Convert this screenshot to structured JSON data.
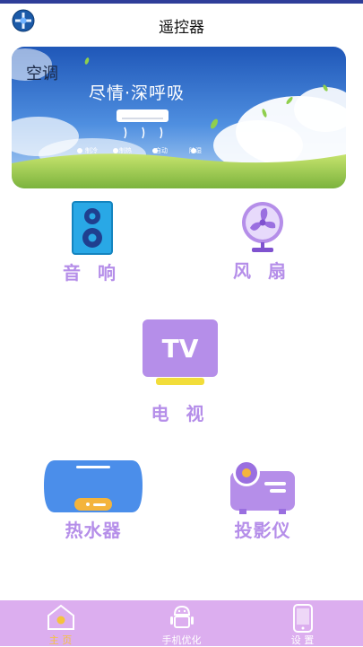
{
  "header": {
    "title": "遥控器",
    "logo_icon": "globe-icon"
  },
  "banner": {
    "label": "空调",
    "slogan": "尽情·深呼吸",
    "modes": [
      "制冷",
      "制热",
      "自动",
      "除湿"
    ],
    "mode_icons": [
      "snowflake-icon",
      "sun-icon",
      "auto-icon",
      "drop-icon"
    ]
  },
  "devices": [
    {
      "label": "音 响",
      "icon": "speaker-icon"
    },
    {
      "label": "风 扇",
      "icon": "fan-icon"
    },
    {
      "label": "电 视",
      "icon": "tv-icon"
    },
    {
      "label": "热水器",
      "icon": "water-heater-icon"
    },
    {
      "label": "投影仪",
      "icon": "projector-icon"
    }
  ],
  "tabbar": {
    "tabs": [
      {
        "label": "主 页",
        "icon": "home-icon"
      },
      {
        "label": "手机优化",
        "icon": "android-icon"
      },
      {
        "label": "设 置",
        "icon": "phone-icon"
      }
    ]
  },
  "colors": {
    "accent": "#b58ee9",
    "tabbar": "#dcaeef",
    "topstripe": "#2f3e99"
  }
}
